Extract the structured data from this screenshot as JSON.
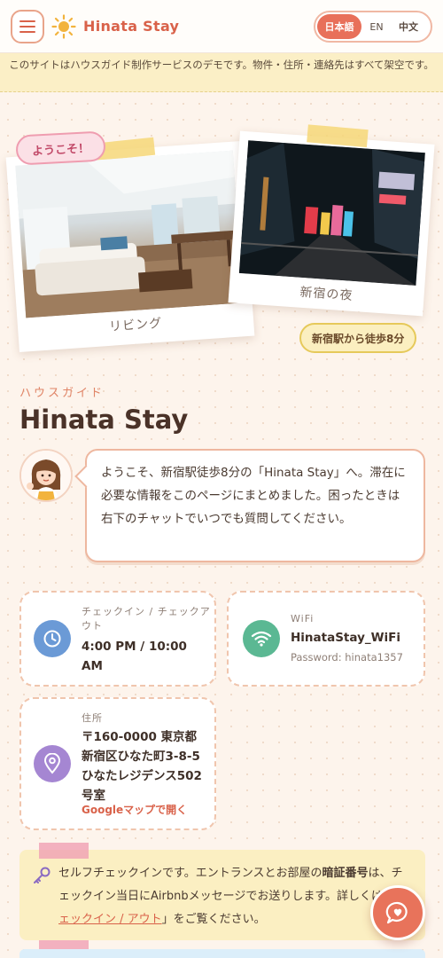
{
  "header": {
    "brand": "Hinata Stay",
    "languages": [
      {
        "label": "日本語",
        "active": true
      },
      {
        "label": "EN",
        "active": false
      },
      {
        "label": "中文",
        "active": false
      }
    ]
  },
  "banner": {
    "text": "このサイトはハウスガイド制作サービスのデモです。物件・住所・連絡先はすべて架空です。"
  },
  "hero": {
    "welcome_tag": "ようこそ！",
    "photos": [
      {
        "caption": "リビング"
      },
      {
        "caption": "新宿の夜"
      }
    ],
    "walk_tag": "新宿駅から徒歩8分"
  },
  "intro": {
    "eyebrow": "ハウスガイド",
    "title": "Hinata Stay",
    "message": "ようこそ、新宿駅徒歩8分の「Hinata Stay」へ。滞在に必要な情報をこのページにまとめました。困ったときは右下のチャットでいつでも質問してください。"
  },
  "cards": {
    "checkin": {
      "label": "チェックイン / チェックアウト",
      "value": "4:00 PM / 10:00 AM"
    },
    "wifi": {
      "label": "WiFi",
      "value": "HinataStay_WiFi",
      "sub": "Password: hinata1357"
    },
    "address": {
      "label": "住所",
      "value": "〒160-0000 東京都新宿区ひなた町3-8-5 ひなたレジデンス502号室",
      "link": "Googleマップで開く"
    }
  },
  "notice": {
    "text_1": "セルフチェックインです。エントランスとお部屋の",
    "bold": "暗証番号",
    "text_2": "は、チェックイン当日にAirbnbメッセージでお送りします。詳しくは「",
    "link": "チェックイン / アウト",
    "text_3": "」をご覧ください。"
  },
  "colors": {
    "accent": "#e8735b",
    "background": "#fdf4ec",
    "banner": "#fbefc6",
    "checkin_icon": "#6b9ad6",
    "wifi_icon": "#5bb893",
    "address_icon": "#a586d2"
  },
  "icons": {
    "menu": "hamburger-icon",
    "logo": "sun-icon",
    "checkin": "clock-icon",
    "wifi": "wifi-icon",
    "address": "map-pin-icon",
    "notice": "key-icon",
    "chat": "chat-heart-icon"
  }
}
